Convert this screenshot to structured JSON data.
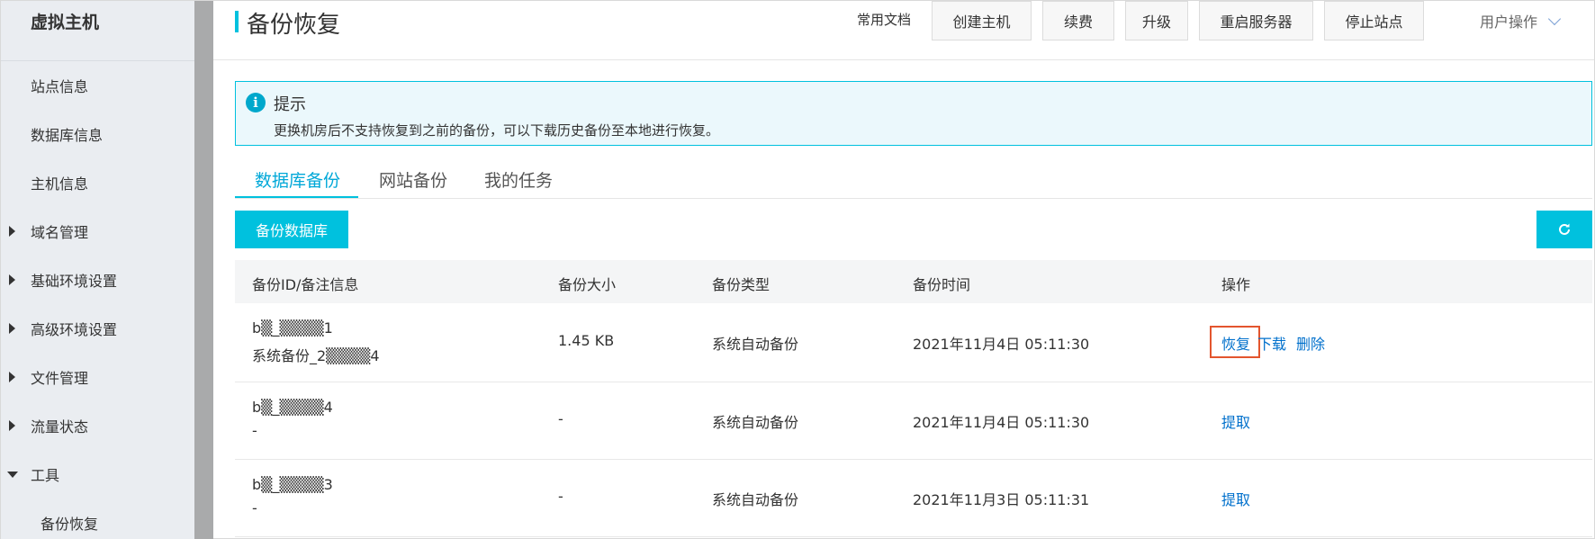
{
  "sidebar": {
    "title": "虚拟主机",
    "items": [
      {
        "label": "站点信息"
      },
      {
        "label": "数据库信息"
      },
      {
        "label": "主机信息"
      },
      {
        "label": "域名管理"
      },
      {
        "label": "基础环境设置"
      },
      {
        "label": "高级环境设置"
      },
      {
        "label": "文件管理"
      },
      {
        "label": "流量状态"
      },
      {
        "label": "工具"
      },
      {
        "label": "备份恢复"
      }
    ]
  },
  "header": {
    "title": "备份恢复",
    "doc_link": "常用文档",
    "buttons": [
      "创建主机",
      "续费",
      "升级",
      "重启服务器",
      "停止站点"
    ],
    "user_ops": "用户操作"
  },
  "tip": {
    "title": "提示",
    "text": "更换机房后不支持恢复到之前的备份，可以下载历史备份至本地进行恢复。",
    "icon": "info-icon"
  },
  "tabs": [
    "数据库备份",
    "网站备份",
    "我的任务"
  ],
  "actions": {
    "backup_db": "备份数据库",
    "refresh_icon": "refresh-icon"
  },
  "table": {
    "headers": [
      "备份ID/备注信息",
      "备份大小",
      "备份类型",
      "备份时间",
      "操作"
    ],
    "rows": [
      {
        "id": "b▒_▒▒▒▒1",
        "note": "系统备份_2▒▒▒▒4",
        "size": "1.45 KB",
        "type": "系统自动备份",
        "time": "2021年11月4日 05:11:30",
        "ops": [
          "恢复",
          "下载",
          "删除"
        ]
      },
      {
        "id": "b▒_▒▒▒▒4",
        "note": "-",
        "size": "-",
        "type": "系统自动备份",
        "time": "2021年11月4日 05:11:30",
        "ops": [
          "提取"
        ]
      },
      {
        "id": "b▒_▒▒▒▒3",
        "note": "-",
        "size": "-",
        "type": "系统自动备份",
        "time": "2021年11月3日 05:11:31",
        "ops": [
          "提取"
        ]
      }
    ]
  }
}
